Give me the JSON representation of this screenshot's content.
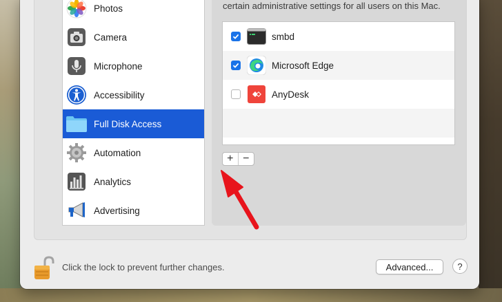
{
  "sidebar": {
    "items": [
      {
        "label": "Photos",
        "icon": "photos-icon"
      },
      {
        "label": "Camera",
        "icon": "camera-icon"
      },
      {
        "label": "Microphone",
        "icon": "microphone-icon"
      },
      {
        "label": "Accessibility",
        "icon": "accessibility-icon"
      },
      {
        "label": "Full Disk Access",
        "icon": "folder-icon",
        "selected": true
      },
      {
        "label": "Automation",
        "icon": "gear-icon"
      },
      {
        "label": "Analytics",
        "icon": "analytics-icon"
      },
      {
        "label": "Advertising",
        "icon": "megaphone-icon"
      }
    ]
  },
  "panel": {
    "description": "certain administrative settings for all users on this Mac.",
    "apps": [
      {
        "name": "smbd",
        "checked": true,
        "icon": "terminal-icon"
      },
      {
        "name": "Microsoft Edge",
        "checked": true,
        "icon": "edge-icon"
      },
      {
        "name": "AnyDesk",
        "checked": false,
        "icon": "anydesk-icon"
      }
    ],
    "add_label": "+",
    "remove_label": "−"
  },
  "footer": {
    "lock_text": "Click the lock to prevent further changes.",
    "advanced_label": "Advanced...",
    "help_label": "?"
  },
  "colors": {
    "selection": "#1a5bd6",
    "checkbox": "#1a73e8",
    "annotation_arrow": "#e8141c"
  }
}
